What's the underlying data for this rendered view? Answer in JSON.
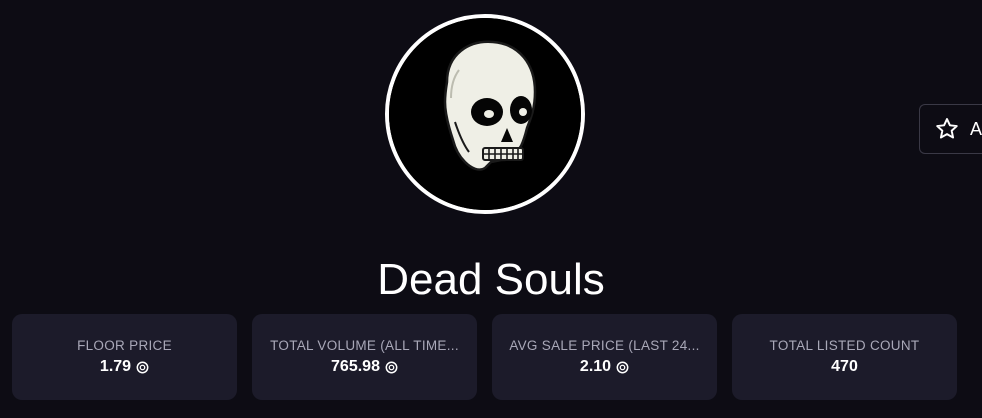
{
  "collection": {
    "name": "Dead Souls",
    "avatar_icon": "skull-icon"
  },
  "watch_button": {
    "label": "A",
    "icon": "star-icon"
  },
  "stats": [
    {
      "label": "FLOOR PRICE",
      "value": "1.79",
      "currency_icon": "sol-coin-icon"
    },
    {
      "label": "TOTAL VOLUME (ALL TIME...",
      "value": "765.98",
      "currency_icon": "sol-coin-icon"
    },
    {
      "label": "AVG SALE PRICE (LAST 24...",
      "value": "2.10",
      "currency_icon": "sol-coin-icon"
    },
    {
      "label": "TOTAL LISTED COUNT",
      "value": "470"
    }
  ],
  "colors": {
    "background": "#0d0c14",
    "card": "#1c1b2a",
    "muted_text": "#a9a8b8",
    "skull": "#efefe6"
  }
}
